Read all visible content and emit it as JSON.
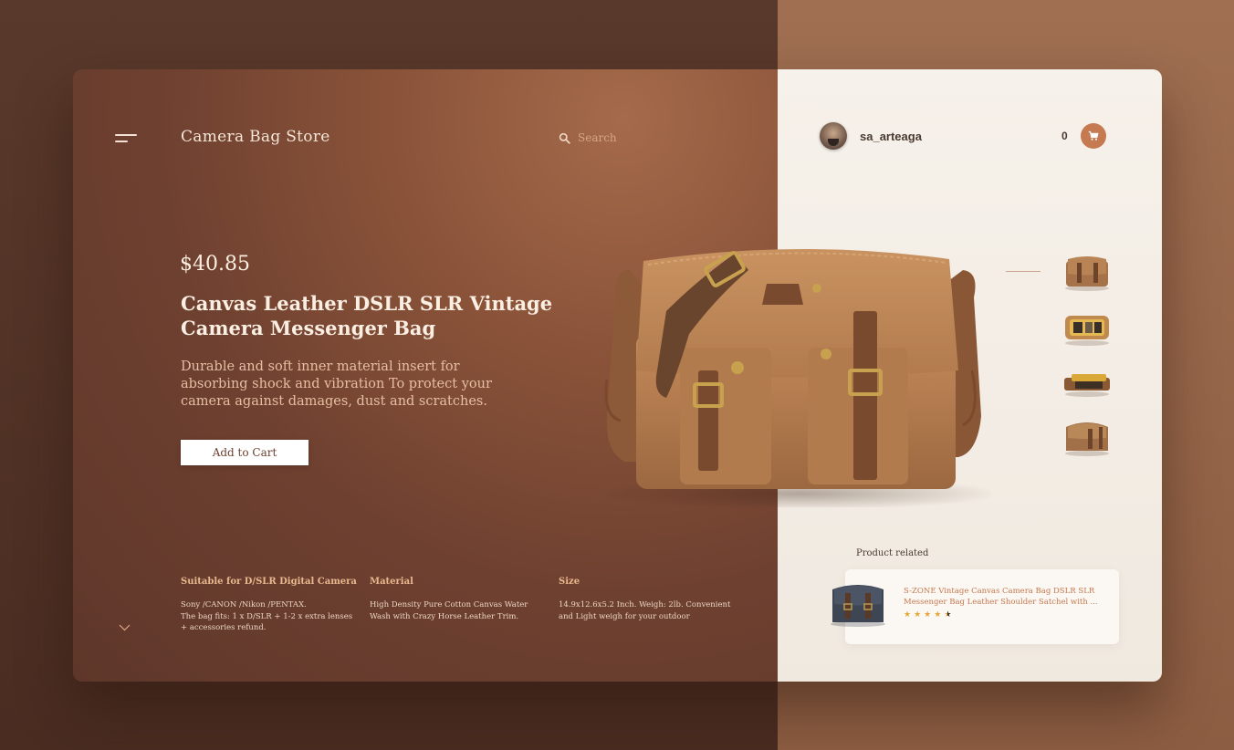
{
  "header": {
    "store_title": "Camera Bag Store",
    "search_placeholder": "Search",
    "username": "sa_arteaga",
    "cart_count": "0"
  },
  "product": {
    "price": "$40.85",
    "title": "Canvas Leather DSLR SLR Vintage Camera Messenger Bag",
    "description": "Durable and soft inner material insert for absorbing shock and vibration To protect your camera against damages, dust and scratches.",
    "add_to_cart_label": "Add to Cart"
  },
  "specs": [
    {
      "title": "Suitable for D/SLR Digital Camera",
      "text": "Sony /CANON /Nikon /PENTAX.\nThe bag fits: 1 x D/SLR + 1-2 x extra lenses\n+ accessories refund."
    },
    {
      "title": "Material",
      "text": "High Density Pure Cotton Canvas Water\nWash with Crazy Horse Leather Trim."
    },
    {
      "title": "Size",
      "text": "14.9x12.6x5.2 Inch. Weigh: 2lb. Convenient\nand Light weigh for your outdoor"
    }
  ],
  "related": {
    "section_title": "Product related",
    "item_title": "S-ZONE Vintage Canvas Camera Bag DSLR SLR Messenger Bag Leather Shoulder Satchel with ...",
    "rating": 4.5
  },
  "colors": {
    "accent": "#c57a52",
    "card_left": "#8a5339",
    "card_right": "#f6f1ea",
    "star": "#e3a73c"
  },
  "icons": {
    "menu": "menu-icon",
    "search": "search-icon",
    "cart": "cart-icon",
    "chevron": "chevron-down-icon"
  }
}
